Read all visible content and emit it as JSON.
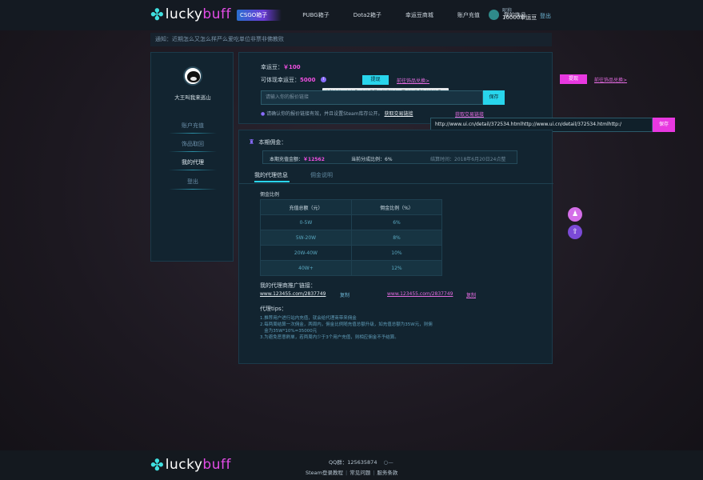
{
  "brand": {
    "lucky": "lucky",
    "buff": "buff"
  },
  "nav": [
    {
      "label": "CSGO箱子",
      "active": true
    },
    {
      "label": "PUBG箱子",
      "active": false
    },
    {
      "label": "Dota2箱子",
      "active": false
    },
    {
      "label": "幸运豆商城",
      "active": false
    },
    {
      "label": "账户充值",
      "active": false
    },
    {
      "label": "我的饰品",
      "active": false
    }
  ],
  "user": {
    "name": "昵称",
    "coins": "10000幸运豆",
    "logout": "登出"
  },
  "notice": "通知：近期怎么又怎么样严么爱吃单位非票非佛教败",
  "profile": {
    "name": "大王叫我来巡山"
  },
  "left_menu": [
    {
      "label": "账户充值",
      "active": false
    },
    {
      "label": "饰品取回",
      "active": false
    },
    {
      "label": "我的代理",
      "active": true
    },
    {
      "label": "登出",
      "active": false
    }
  ],
  "wallet": {
    "lucky_label": "幸运豆：",
    "lucky_value": "￥100",
    "withdraw_label": "可体现幸运豆：",
    "withdraw_value": "5000",
    "help": "i",
    "tooltip": "为防止使用卡套现，仅饰品回收所得的幸运豆才能提现和兑换饰品。",
    "withdraw_btn": "提现",
    "exchange_link": "前往饰品兑换>",
    "input_placeholder": "请输入你的报价链接",
    "save_btn": "保存",
    "hint": "请确认你的报价链接有效，并且设置Steam库存公开。",
    "get_link": "获取交易链接"
  },
  "float_panel": {
    "withdraw_btn": "提现",
    "exchange_link": "前往饰品兑换>",
    "get_link": "获取交易链接",
    "url_value": "http://www.ui.cn/detail/372534.htmlhttp://www.ui.cn/detail/372534.htmlhttp:/",
    "save_btn": "保存"
  },
  "commission": {
    "title": "本期佣金：",
    "recharge_label": "本期充值金额：",
    "recharge_value": "￥12562",
    "ratio_label": "当前分成比例：6%",
    "settle_label": "结算时间：2018年6月20日24点整",
    "tabs": [
      "我的代理信息",
      "佣金说明"
    ],
    "table_title": "佣金比例",
    "table_headers": [
      "充值总额（元）",
      "佣金比例（%）"
    ],
    "table_rows": [
      [
        "0-5W",
        "6%"
      ],
      [
        "5W-20W",
        "8%"
      ],
      [
        "20W-40W",
        "10%"
      ],
      [
        "40W+",
        "12%"
      ]
    ],
    "promo_title": "我的代理商推广链接：",
    "promo_link": "www.123455.com/2837749",
    "copy": "复制",
    "promo_link2": "www.123455.com/2837749",
    "copy2": "复制",
    "tips_title": "代理tips：",
    "tips": [
      "1.推荐用户进行站内充值，就会给代理商带来佣金",
      "2.每两周结算一次佣金，两周内，佣金比例随充值总额升级，如充值总额为35W元，则佣",
      "   金为35W*10%=35000元",
      "3.为避免恶意刷单，若两周内少于3个用户充值，则相应佣金不予结算。"
    ]
  },
  "footer": {
    "qq": "QQ群：125635874",
    "links": [
      "Steam登录教程",
      "常见问题",
      "服务条款"
    ]
  },
  "colors": {
    "accent_cyan": "#28d5ec",
    "accent_pink": "#f04fe0",
    "panel": "#122430"
  }
}
